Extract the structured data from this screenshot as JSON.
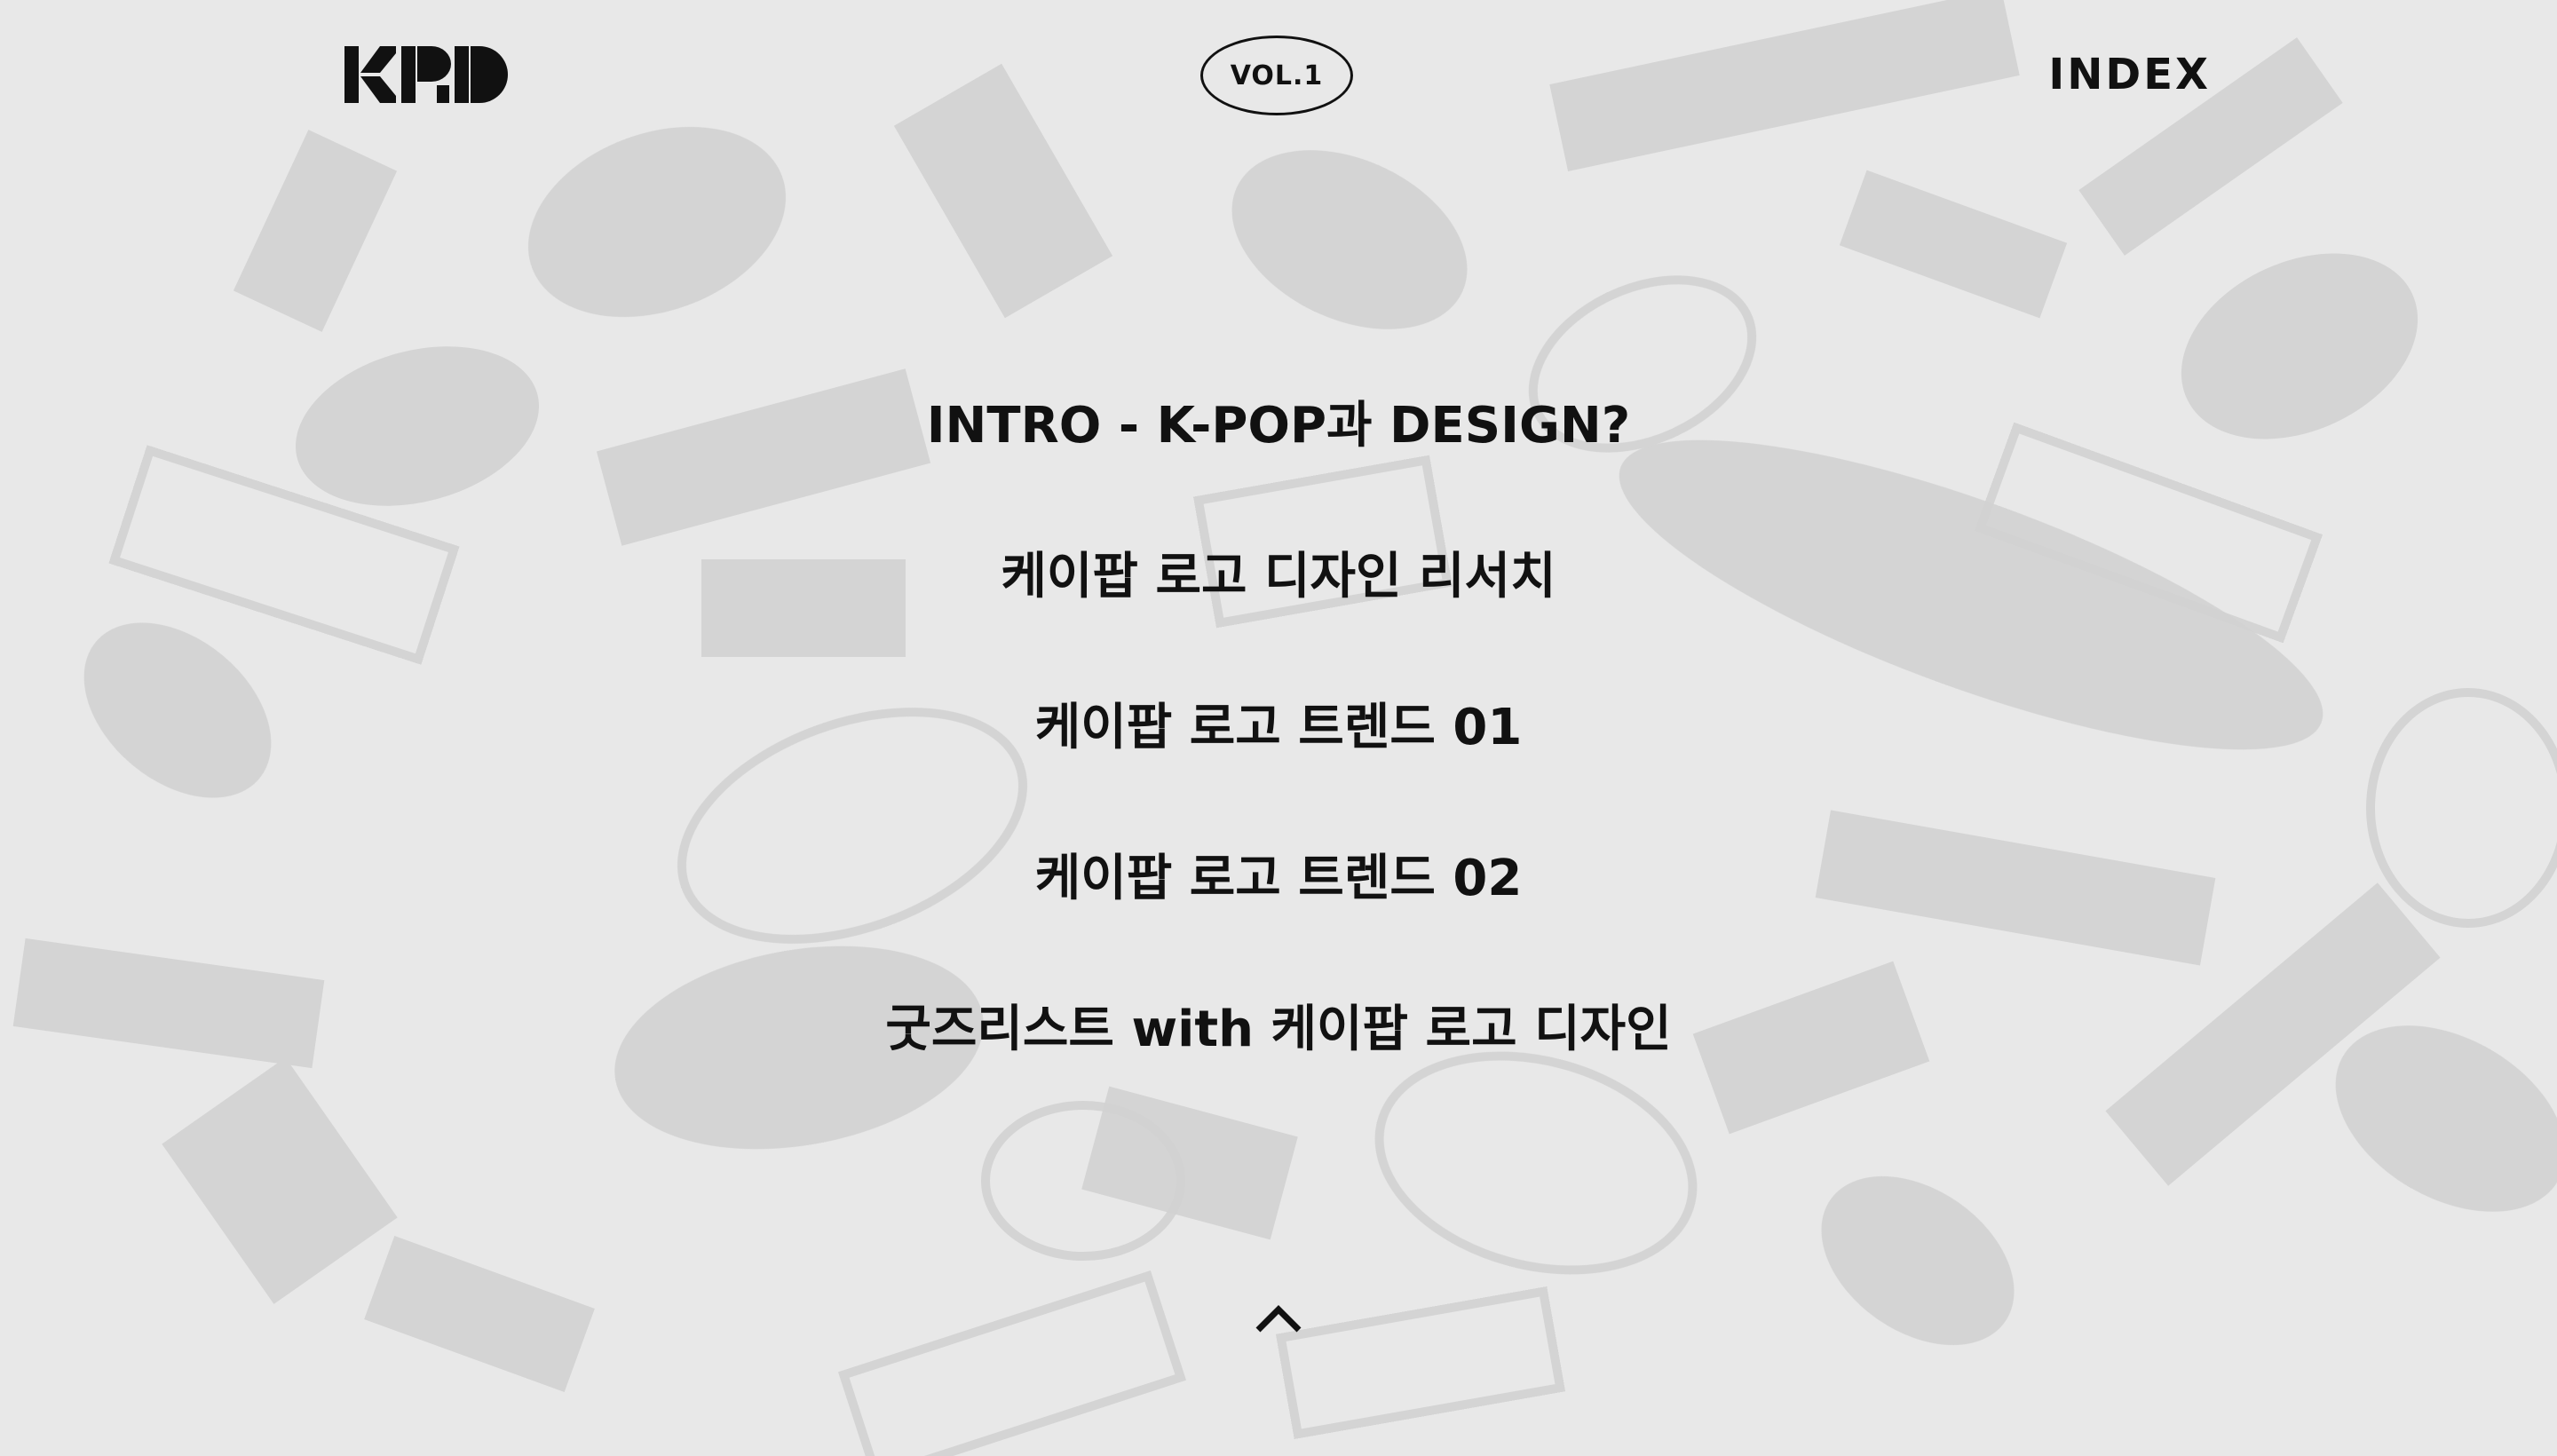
{
  "header": {
    "logo_icon": "kpd-logo-icon",
    "vol_label": "VOL.1",
    "index_label": "INDEX"
  },
  "menu": {
    "items": [
      {
        "label": "INTRO - K-POP과 DESIGN?"
      },
      {
        "label": "케이팝 로고 디자인 리서치"
      },
      {
        "label": "케이팝 로고 트렌드 01"
      },
      {
        "label": "케이팝 로고 트렌드 02"
      },
      {
        "label": "굿즈리스트 with 케이팝 로고 디자인"
      }
    ]
  },
  "footer": {
    "up_icon": "chevron-up-icon"
  },
  "colors": {
    "background": "#e7e7e7",
    "text": "#111111",
    "pattern": "#cfcfcf"
  }
}
